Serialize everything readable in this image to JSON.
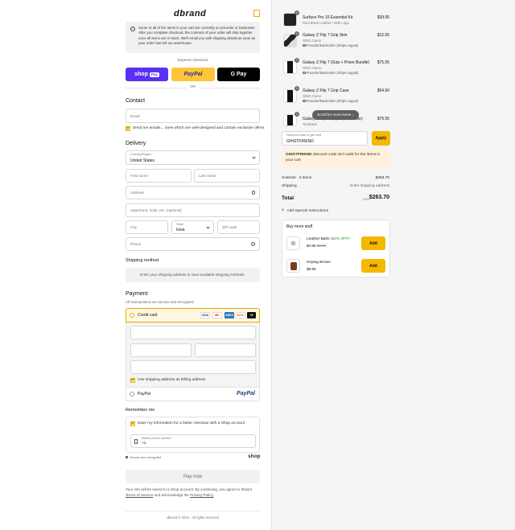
{
  "brand": {
    "logo": "dbrand",
    "cart_icon": "bag-icon"
  },
  "notice": {
    "text": "Some or all of the items in your cart are currently on preorder or backorder. After you complete checkout, the contents of your order will ship together once all items are in stock. We'll email you with shipping details as soon as your order has left our warehouse."
  },
  "express": {
    "label": "Express checkout",
    "shop_pay": "shop",
    "shop_pay_badge": "Pay",
    "paypal": "PayPal",
    "gpay": "G Pay",
    "or": "OR"
  },
  "contact": {
    "title": "Contact",
    "email_placeholder": "Email",
    "newsletter": "Send me emails... ones which are well-designed and contain exclusive offers."
  },
  "delivery": {
    "title": "Delivery",
    "country_label": "Country/Region",
    "country_value": "United States",
    "first_name": "First name",
    "last_name": "Last name",
    "address": "Address",
    "apartment": "Apartment, suite, etc. (optional)",
    "city": "City",
    "state_label": "State",
    "state_value": "Iowa",
    "zip": "ZIP code",
    "phone": "Phone"
  },
  "shipping": {
    "title": "Shipping method",
    "message": "Enter your shipping address to view available shipping methods."
  },
  "payment": {
    "title": "Payment",
    "subtitle": "All transactions are secure and encrypted.",
    "credit_card": "Credit card",
    "cards": [
      "VISA",
      "MC",
      "AMEX",
      "DISC",
      "+5"
    ],
    "billing_same": "Use shipping address as billing address",
    "paypal": "PayPal",
    "paypal_logo": "PayPal"
  },
  "remember": {
    "title": "Remember me",
    "save_info": "Save my information for a faster checkout with a Shop account",
    "mobile_label": "Mobile phone number",
    "mobile_value": "+1",
    "secure": "Secure and encrypted",
    "shop_logo": "shop"
  },
  "pay_now": "Pay now",
  "legal": {
    "text": "Your info will be saved to a Shop account. By continuing, you agree to Shop's",
    "terms": "Terms of Service",
    "and": "and acknowledge the",
    "privacy": "Privacy Policy."
  },
  "footer": "dbrand © 4024 . All rights reserved",
  "cart": {
    "items": [
      {
        "qty": "1",
        "name": "Surface Pro 10 Essential Kit",
        "sub": "Real Black Leather / With Logo",
        "note": "",
        "price": "$39.95"
      },
      {
        "qty": "1",
        "name": "Galaxy Z Flip 7 Grip Skin",
        "sub": "Glitch Camo",
        "note": "Preorder/Backorder (Ships August)",
        "price": "$12.95"
      },
      {
        "qty": "1",
        "name": "Galaxy Z Flip 7 (Grip + Prism Bundle)",
        "sub": "Glitch Camo",
        "note": "Preorder/Backorder (Ships August)",
        "price": "$75.95"
      },
      {
        "qty": "1",
        "name": "Galaxy Z Flip 7 Grip Case",
        "sub": "Glitch Camo",
        "note": "Preorder/Backorder (Ships August)",
        "price": "$54.90"
      },
      {
        "qty": "1",
        "name": "Galaxy Z Flip 7 ... (Grip + Bundle)",
        "sub": "Teardown",
        "note": "",
        "price": "$79.95"
      }
    ],
    "scroll_hint": "Scroll for more items",
    "discount_label": "Discount code or gift card",
    "discount_value": "GHISTFRIEND",
    "apply": "Apply",
    "discount_error_code": "GHISTFRIEND",
    "discount_error_rest": "discount code isn't valid for the items in your cart",
    "subtotal_label": "Subtotal · 5 items",
    "subtotal_value": "$263.70",
    "shipping_label": "Shipping",
    "shipping_value": "Enter shipping address",
    "total_label": "Total",
    "total_currency": "USD",
    "total_value": "$263.70",
    "special": "Add Special Instructions",
    "upsell_title": "Buy more stuff",
    "upsell": [
      {
        "name": "Leather Balm",
        "discount": "(50% OFF)",
        "price": "$4.95",
        "old": "$9.95",
        "add": "Add"
      },
      {
        "name": "Keytag Brown",
        "discount": "",
        "price": "$9.95",
        "old": "",
        "add": "Add"
      }
    ]
  },
  "colors": {
    "accent": "#f5b800",
    "shop_pay": "#5a31f4",
    "paypal": "#ffc439"
  }
}
